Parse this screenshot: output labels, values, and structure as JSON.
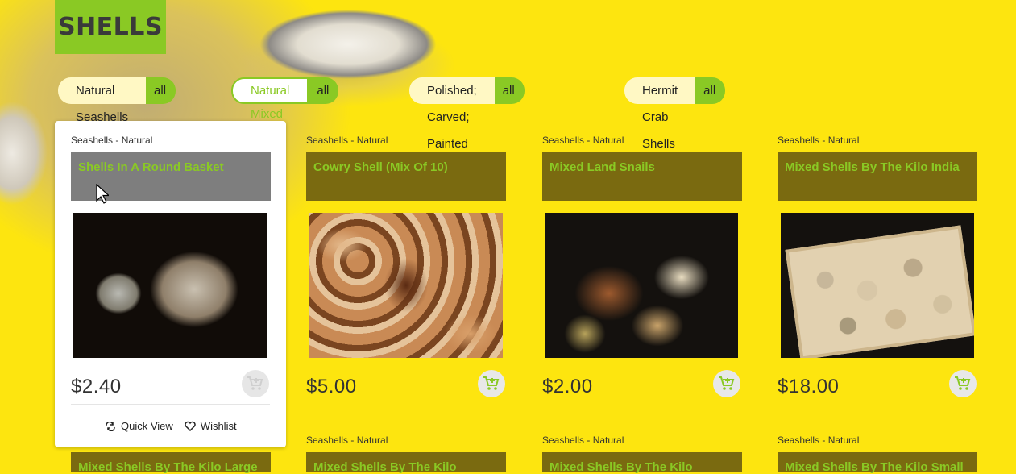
{
  "page": {
    "title": "SHELLS"
  },
  "filters": [
    {
      "label": "Natural Seashells",
      "all": "all",
      "active": false
    },
    {
      "label": "Natural Mixed Bag",
      "all": "all",
      "active": true
    },
    {
      "label": "Polished; Carved; Painted",
      "all": "all",
      "active": false
    },
    {
      "label": "Hermit Crab Shells",
      "all": "all",
      "active": false
    }
  ],
  "products": [
    {
      "category": "Seashells - Natural",
      "name": "Shells In A Round Basket",
      "price": "$2.40"
    },
    {
      "category": "Seashells - Natural",
      "name": "Cowry Shell (Mix Of 10)",
      "price": "$5.00"
    },
    {
      "category": "Seashells - Natural",
      "name": "Mixed Land Snails",
      "price": "$2.00"
    },
    {
      "category": "Seashells - Natural",
      "name": "Mixed Shells By The Kilo India",
      "price": "$18.00"
    }
  ],
  "products_row2": [
    {
      "category": "",
      "name": "Mixed Shells By The Kilo Large"
    },
    {
      "category": "Seashells - Natural",
      "name": "Mixed Shells By The Kilo"
    },
    {
      "category": "Seashells - Natural",
      "name": "Mixed Shells By The Kilo"
    },
    {
      "category": "Seashells - Natural",
      "name": "Mixed Shells By The Kilo Small"
    }
  ],
  "hover_actions": {
    "quick_view": "Quick View",
    "wishlist": "Wishlist"
  },
  "colors": {
    "background": "#fde50f",
    "accent_green": "#8ac924",
    "name_box": "#7a6a10"
  },
  "icons": [
    "add-to-cart-icon",
    "quick-view-icon",
    "heart-icon",
    "mouse-cursor-icon"
  ]
}
